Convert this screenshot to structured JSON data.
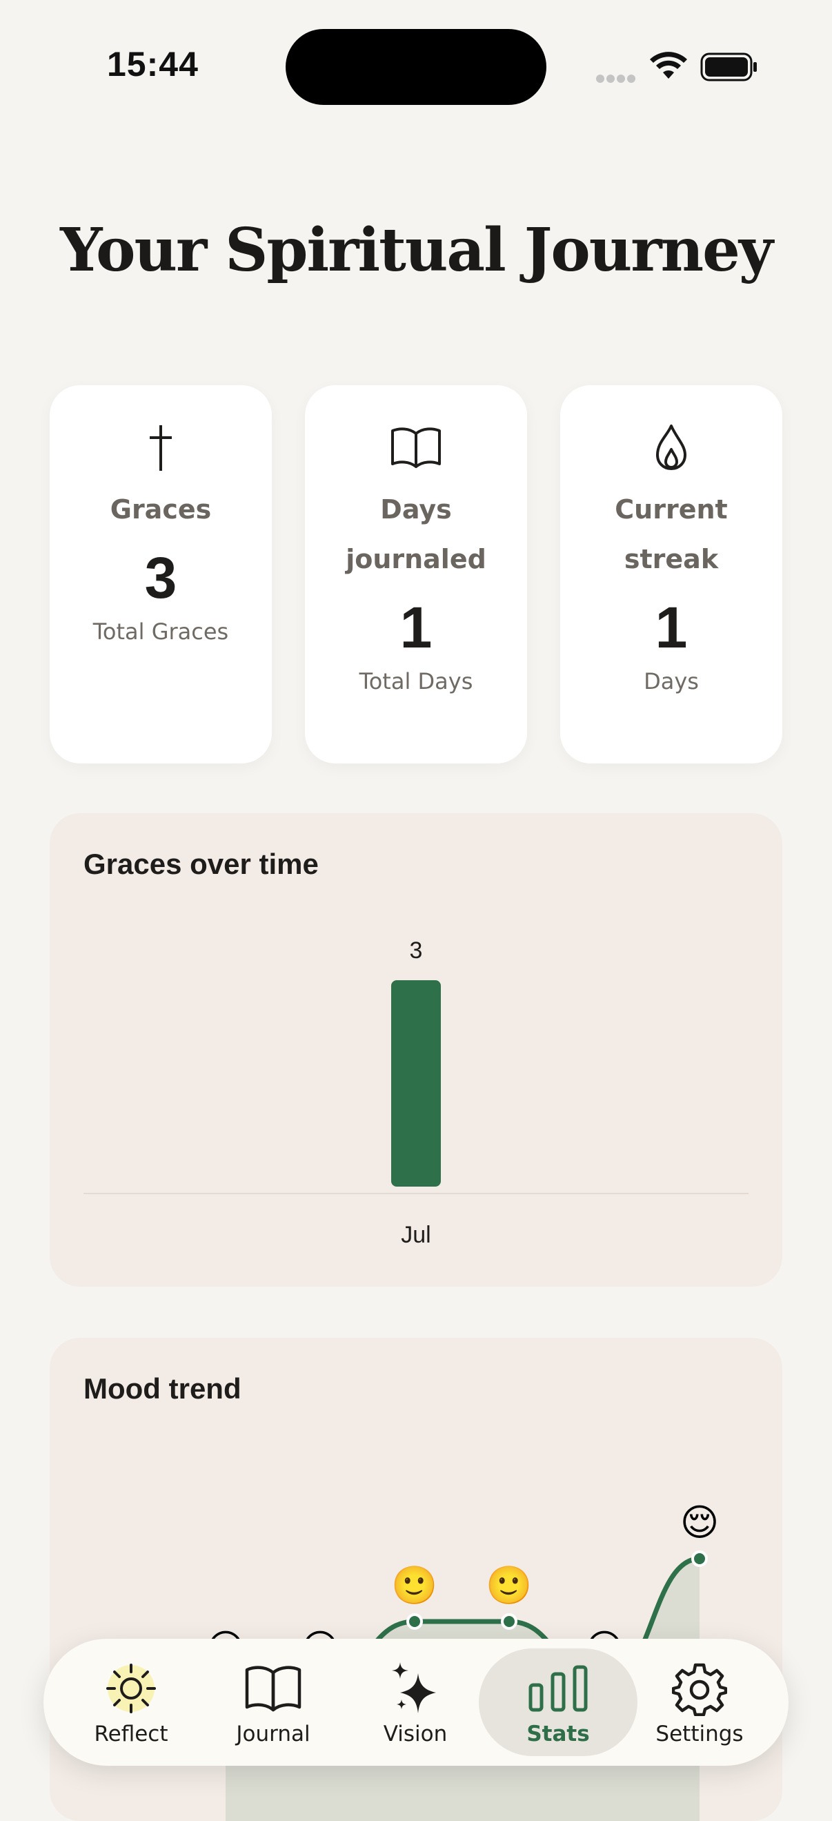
{
  "status_bar": {
    "time": "15:44"
  },
  "page": {
    "title": "Your Spiritual Journey"
  },
  "stats": [
    {
      "icon": "cross-icon",
      "label": "Graces",
      "value": "3",
      "sub": "Total Graces"
    },
    {
      "icon": "open-book-icon",
      "label": "Days journaled",
      "value": "1",
      "sub": "Total Days"
    },
    {
      "icon": "flame-icon",
      "label": "Current streak",
      "value": "1",
      "sub": "Days"
    }
  ],
  "graces_chart": {
    "title": "Graces over time",
    "chart_data": {
      "type": "bar",
      "categories": [
        "Jul"
      ],
      "values": [
        3
      ],
      "title": "Graces over time",
      "bar_color": "#2e7049"
    }
  },
  "mood_chart": {
    "title": "Mood trend",
    "chart_data": {
      "type": "area",
      "points": [
        "😐",
        "😐",
        "🙂",
        "🙂",
        "😐",
        "😌"
      ],
      "values": [
        1,
        1,
        2,
        2,
        1,
        3
      ],
      "title": "Mood trend",
      "line_color": "#2e7049"
    }
  },
  "nav": {
    "items": [
      {
        "label": "Reflect",
        "icon": "sun-icon"
      },
      {
        "label": "Journal",
        "icon": "book-icon"
      },
      {
        "label": "Vision",
        "icon": "sparkles-icon"
      },
      {
        "label": "Stats",
        "icon": "bar-chart-icon"
      },
      {
        "label": "Settings",
        "icon": "gear-icon"
      }
    ],
    "active": "Stats",
    "accent": "#2e6f4a"
  }
}
